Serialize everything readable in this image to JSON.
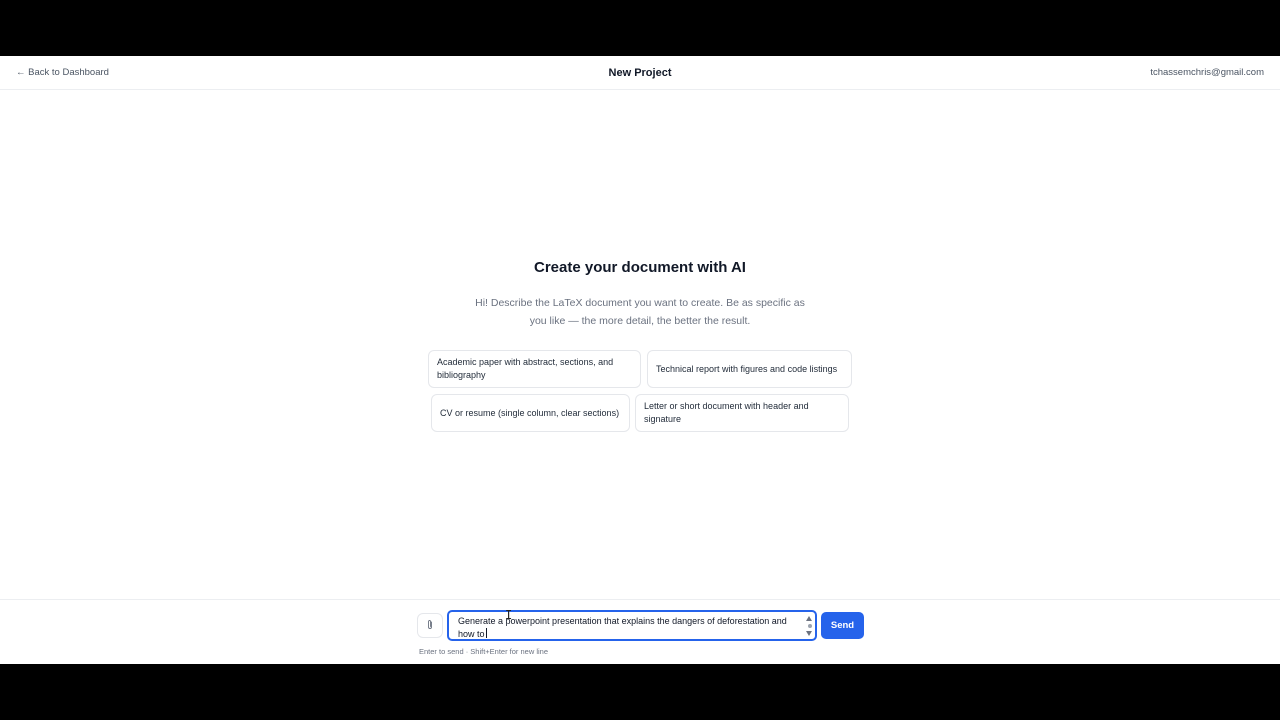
{
  "header": {
    "back_label": "← Back to Dashboard",
    "title": "New Project",
    "user_email": "tchassemchris@gmail.com"
  },
  "hero": {
    "title": "Create your document with AI",
    "description": "Hi! Describe the LaTeX document you want to create. Be as specific as you like — the more detail, the better the result."
  },
  "suggestions": [
    "Academic paper with abstract, sections, and bibliography",
    "Technical report with figures and code listings",
    "CV or resume (single column, clear sections)",
    "Letter or short document with header and signature"
  ],
  "composer": {
    "attach_icon": "paperclip-icon",
    "input_value": "Generate a powerpoint presentation that explains the dangers of deforestation and how to",
    "send_label": "Send",
    "hint": "Enter to send · Shift+Enter for new line"
  },
  "colors": {
    "accent": "#2563eb",
    "text_muted": "#6b7280",
    "border": "#e5e7eb"
  }
}
